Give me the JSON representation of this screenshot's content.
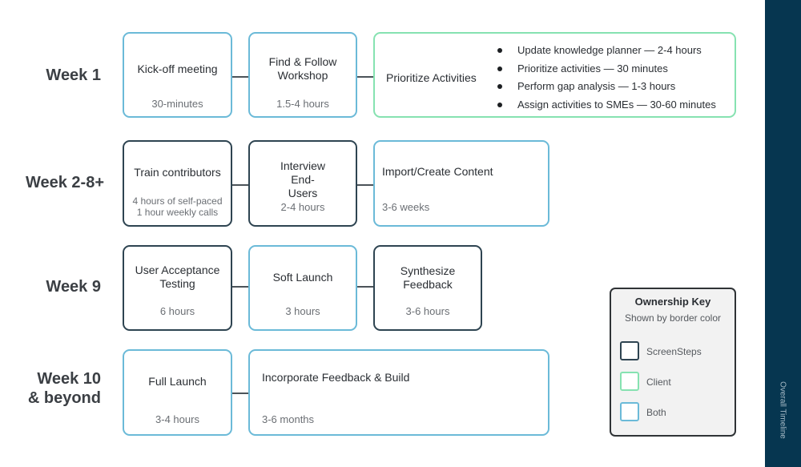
{
  "colors": {
    "screensteps": "#2e4451",
    "client": "#86e2b1",
    "both": "#6bbad8",
    "sidebar": "#063650"
  },
  "rows": [
    {
      "week": "Week 1",
      "tasks": [
        {
          "title": "Kick-off meeting",
          "duration": "30-minutes",
          "owner": "Both"
        },
        {
          "title": "Find & Follow Workshop",
          "duration": "1.5-4 hours",
          "owner": "Both"
        },
        {
          "title": "Prioritize Activities",
          "owner": "Client",
          "bullets": [
            "Update knowledge planner — 2-4 hours",
            "Prioritize activities — 30 minutes",
            "Perform gap analysis — 1-3 hours",
            "Assign activities to SMEs — 30-60 minutes"
          ]
        }
      ]
    },
    {
      "week": "Week 2-8+",
      "tasks": [
        {
          "title": "Train contributors",
          "duration": "4 hours of self-paced",
          "duration2": "1 hour weekly calls",
          "owner": "ScreenSteps"
        },
        {
          "title": "Interview End-Users",
          "duration": "2-4 hours",
          "owner": "ScreenSteps"
        },
        {
          "title": "Import/Create Content",
          "duration": "3-6 weeks",
          "owner": "Both"
        }
      ]
    },
    {
      "week": "Week 9",
      "tasks": [
        {
          "title": "User Acceptance Testing",
          "duration": "6 hours",
          "owner": "ScreenSteps"
        },
        {
          "title": "Soft Launch",
          "duration": "3 hours",
          "owner": "Both"
        },
        {
          "title": "Synthesize Feedback",
          "duration": "3-6 hours",
          "owner": "ScreenSteps"
        }
      ]
    },
    {
      "week_line1": "Week 10",
      "week_line2": "& beyond",
      "tasks": [
        {
          "title": "Full Launch",
          "duration": "3-4 hours",
          "owner": "Both"
        },
        {
          "title": "Incorporate Feedback & Build",
          "duration": "3-6 months",
          "owner": "Both"
        }
      ]
    }
  ],
  "key": {
    "title": "Ownership Key",
    "subtitle": "Shown by border color",
    "items": [
      {
        "label": "ScreenSteps"
      },
      {
        "label": "Client"
      },
      {
        "label": "Both"
      }
    ]
  },
  "sidebar": {
    "label": "Overall Timeline"
  }
}
